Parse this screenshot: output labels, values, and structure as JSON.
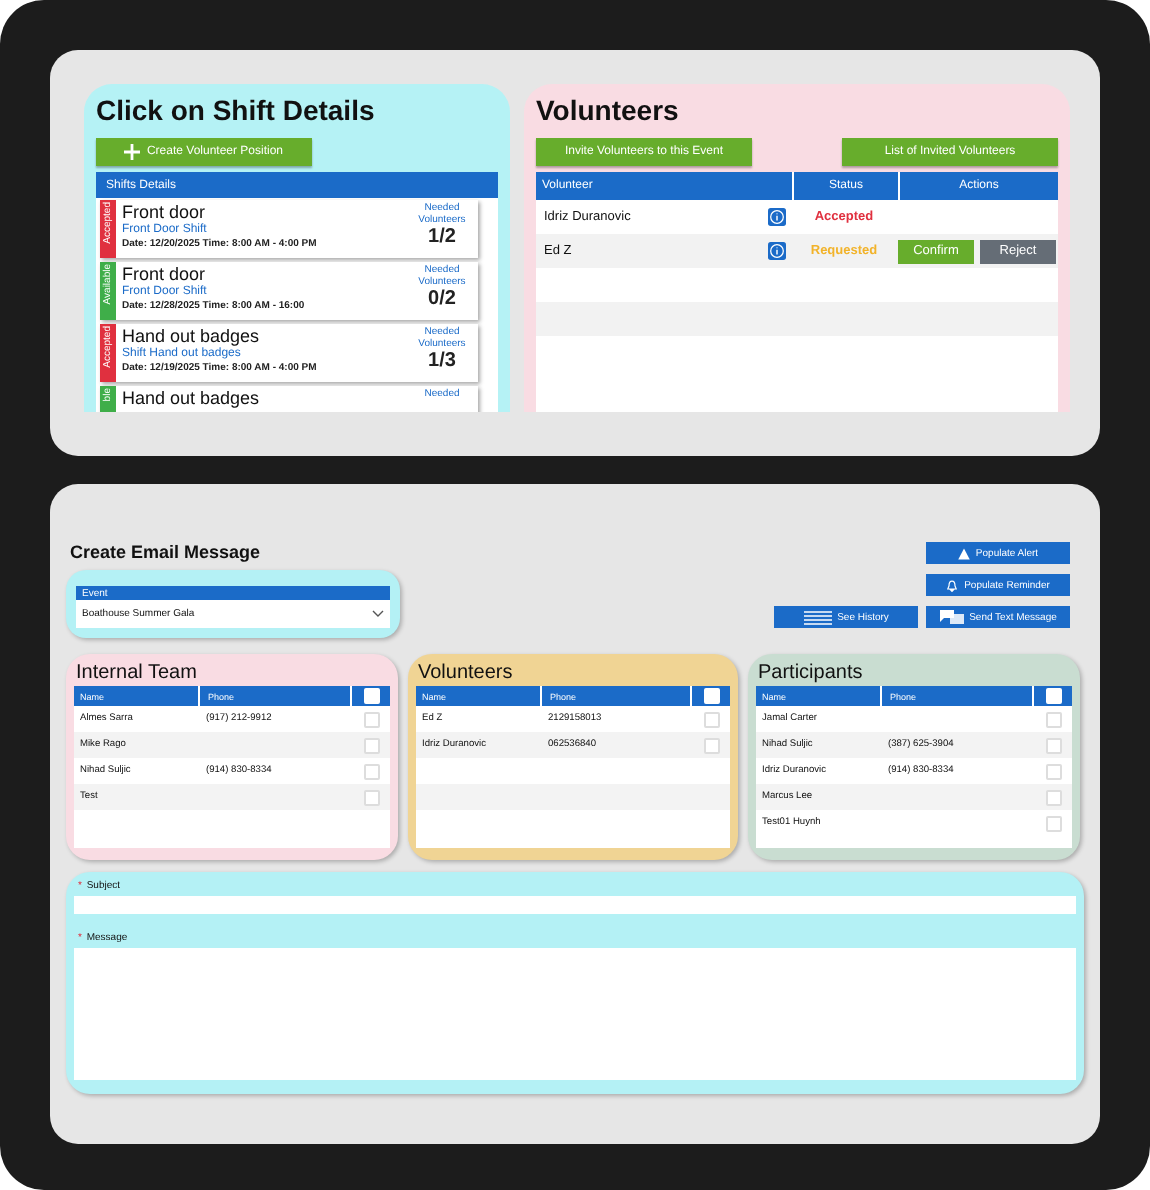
{
  "shifts_panel": {
    "title": "Click on Shift Details",
    "create_button": "Create Volunteer Position",
    "list_header": "Shifts Details",
    "shifts": [
      {
        "color": "#e0303f",
        "status_label": "Accepted",
        "title": "Front door",
        "subtitle": "Front Door Shift",
        "date": "Date: 12/20/2025 Time: 8:00 AM - 4:00 PM",
        "needed_label": "Needed Volunteers",
        "count": "1/2"
      },
      {
        "color": "#3fae49",
        "status_label": "Available",
        "title": "Front door",
        "subtitle": "Front Door Shift",
        "date": "Date: 12/28/2025 Time: 8:00 AM - 16:00",
        "needed_label": "Needed Volunteers",
        "count": "0/2"
      },
      {
        "color": "#e0303f",
        "status_label": "Accepted",
        "title": "Hand out badges",
        "subtitle": "Shift Hand out badges",
        "date": "Date: 12/19/2025 Time: 8:00 AM - 4:00 PM",
        "needed_label": "Needed Volunteers",
        "count": "1/3"
      },
      {
        "color": "#3fae49",
        "status_label": "ble",
        "title": "Hand out badges",
        "needed_label": "Needed"
      }
    ]
  },
  "volunteers_panel": {
    "title": "Volunteers",
    "invite_button": "Invite Volunteers to this Event",
    "list_button": "List of Invited Volunteers",
    "columns": [
      "Volunteer",
      "Status",
      "Actions"
    ],
    "rows": [
      {
        "name": "Idriz Duranovic",
        "color": "#e0303f",
        "status_label": "Accepted"
      },
      {
        "name": "Ed Z",
        "color": "#f2b32a",
        "status_label": "Requested",
        "actions": [
          "Confirm",
          "Reject"
        ]
      }
    ]
  },
  "email": {
    "title": "Create Email Message",
    "event_label": "Event",
    "event_value": "Boathouse Summer Gala",
    "buttons": [
      {
        "kind": "alert",
        "label": "Populate Alert"
      },
      {
        "kind": "reminder",
        "label": "Populate Reminder"
      },
      {
        "kind": "history",
        "label": "See History"
      },
      {
        "kind": "text",
        "label": "Send Text Message"
      }
    ],
    "lists": [
      {
        "title": "Internal Team",
        "color": "#f9dce3",
        "columns": [
          "Name",
          "Phone"
        ],
        "select_all_checked": false,
        "rows": [
          {
            "name": "Almes Sarra",
            "phone": "(917) 212-9912",
            "checked": false
          },
          {
            "name": "Mike Rago",
            "checked": false
          },
          {
            "name": "Nihad Suljic",
            "phone": "(914) 830-8334",
            "checked": false
          },
          {
            "name": "Test",
            "checked": false
          }
        ]
      },
      {
        "title": "Volunteers",
        "color": "#f0d494",
        "columns": [
          "Name",
          "Phone"
        ],
        "select_all_checked": false,
        "rows": [
          {
            "name": "Ed Z",
            "phone": "2129158013",
            "checked": false
          },
          {
            "name": "Idriz Duranovic",
            "phone": "062536840",
            "checked": false
          }
        ]
      },
      {
        "title": "Participants",
        "color": "#c9ddd1",
        "columns": [
          "Name",
          "Phone"
        ],
        "select_all_checked": false,
        "rows": [
          {
            "name": "Jamal Carter",
            "checked": false
          },
          {
            "name": "Nihad Suljic",
            "phone": "(387) 625-3904",
            "checked": false
          },
          {
            "name": "Idriz Duranovic",
            "phone": "(914) 830-8334",
            "checked": false
          },
          {
            "name": "Marcus Lee",
            "checked": false
          },
          {
            "name": "Test01 Huynh",
            "checked": false
          }
        ]
      }
    ],
    "subject_label": "Subject",
    "message_label": "Message",
    "required_mark": "*"
  }
}
